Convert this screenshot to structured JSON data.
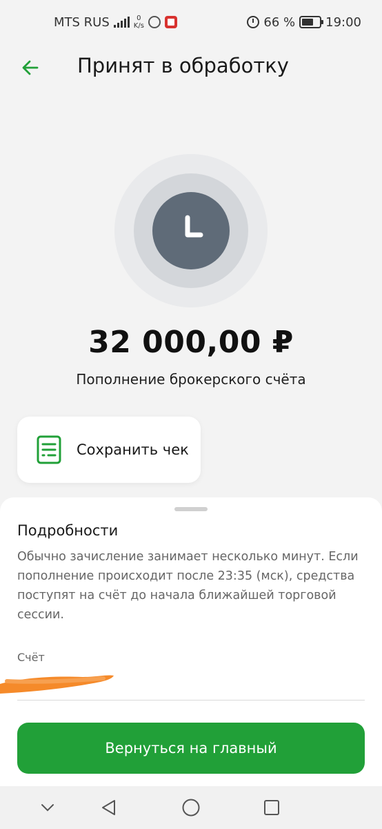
{
  "status_bar": {
    "carrier": "MTS RUS",
    "net_speed_value": "0",
    "net_speed_unit": "K/s",
    "battery_percent": "66 %",
    "battery_level": 0.66,
    "time": "19:00"
  },
  "header": {
    "title": "Принят в обработку",
    "back_icon": "arrow-left-icon"
  },
  "status_icon": "clock-icon",
  "transaction": {
    "amount": "32 000,00 ₽",
    "description": "Пополнение брокерского счёта"
  },
  "save_receipt": {
    "label": "Сохранить чек",
    "icon": "receipt-icon"
  },
  "details": {
    "title": "Подробности",
    "text": "Обычно зачисление занимает несколько минут. Если пополнение происходит после 23:35 (мск), средства поступят на счёт до начала ближайшей торговой сессии.",
    "account_label": "Счёт"
  },
  "primary_button": {
    "label": "Вернуться на главный"
  },
  "nav": {
    "items": [
      "chevron-down-icon",
      "back-triangle-icon",
      "home-circle-icon",
      "recents-square-icon"
    ]
  },
  "colors": {
    "accent_green": "#21a038",
    "clock_dark": "#5f6b78",
    "redaction_orange": "#f58a2a"
  }
}
